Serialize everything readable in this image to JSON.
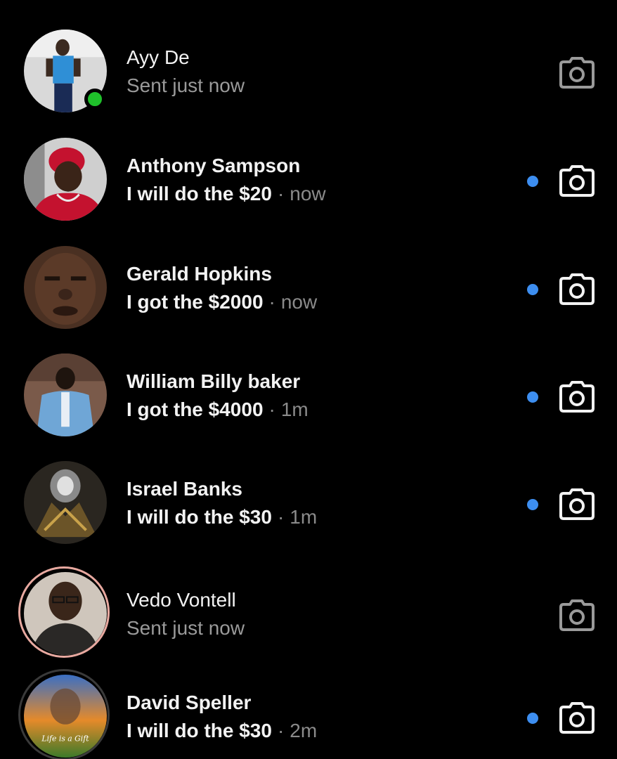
{
  "conversations": [
    {
      "name": "Ayy De",
      "preview": "Sent just now",
      "time": "",
      "unread": false,
      "online": true,
      "ring": "none"
    },
    {
      "name": "Anthony Sampson",
      "preview": "I will do the $20",
      "time": "now",
      "unread": true,
      "online": false,
      "ring": "none"
    },
    {
      "name": "Gerald Hopkins",
      "preview": "I got the $2000",
      "time": "now",
      "unread": true,
      "online": false,
      "ring": "none"
    },
    {
      "name": "William Billy baker",
      "preview": "I got the $4000",
      "time": "1m",
      "unread": true,
      "online": false,
      "ring": "none"
    },
    {
      "name": "Israel Banks",
      "preview": "I will do the $30",
      "time": "1m",
      "unread": true,
      "online": false,
      "ring": "none"
    },
    {
      "name": "Vedo Vontell",
      "preview": "Sent just now",
      "time": "",
      "unread": false,
      "online": false,
      "ring": "story"
    },
    {
      "name": "David Speller",
      "preview": "I will do the $30",
      "time": "2m",
      "unread": true,
      "online": false,
      "ring": "seen"
    }
  ],
  "avatar_texts": {
    "david_speller": "Life is a Gift"
  },
  "separator": "·",
  "colors": {
    "background": "#000000",
    "unread_dot": "#3d8ef0",
    "online_dot": "#1fc12b",
    "story_ring": "#e8a9a0"
  },
  "icons": {
    "camera": "camera-icon"
  }
}
